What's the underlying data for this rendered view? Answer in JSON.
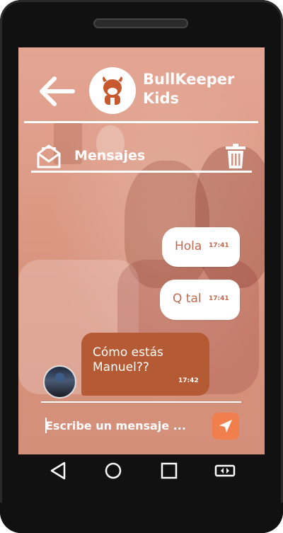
{
  "app": {
    "brand_line1": "BullKeeper",
    "brand_line2": "Kids"
  },
  "section": {
    "title": "Mensajes"
  },
  "messages": [
    {
      "text": "Hola",
      "time": "17:41",
      "from": "me"
    },
    {
      "text": "Q tal",
      "time": "17:41",
      "from": "me"
    },
    {
      "text": "Cómo estás Manuel??",
      "time": "17:42",
      "from": "contact"
    }
  ],
  "composer": {
    "placeholder": "Escribe un mensaje ..."
  },
  "colors": {
    "accent": "#f07f4d",
    "incoming_bubble": "#b45a34",
    "outgoing_text": "#c16a4d"
  },
  "icons": {
    "back": "arrow-left-icon",
    "logo": "bull-logo-icon",
    "mail": "envelope-open-icon",
    "trash": "trash-icon",
    "send": "send-icon",
    "nav_back": "triangle-back-icon",
    "nav_home": "circle-home-icon",
    "nav_recent": "square-recent-icon",
    "nav_rotate": "screen-rotate-icon"
  }
}
